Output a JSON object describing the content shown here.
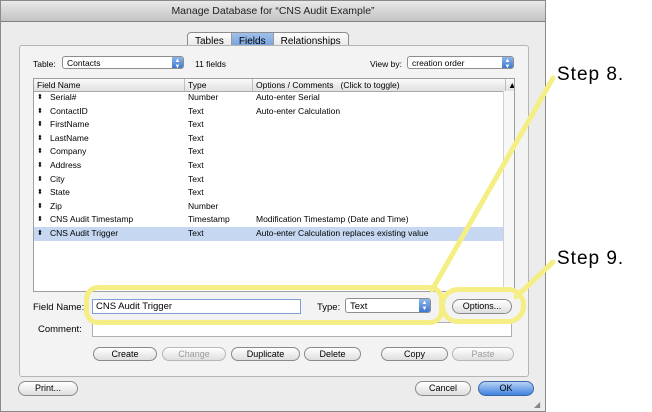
{
  "window": {
    "title": "Manage Database for “CNS Audit Example”"
  },
  "tabs": [
    {
      "label": "Tables",
      "active": false
    },
    {
      "label": "Fields",
      "active": true
    },
    {
      "label": "Relationships",
      "active": false
    }
  ],
  "toolbar": {
    "table_label": "Table:",
    "table_value": "Contacts",
    "field_count": "11 fields",
    "viewby_label": "View by:",
    "viewby_value": "creation order"
  },
  "columns": [
    "Field Name",
    "Type",
    "Options / Comments   (Click to toggle)"
  ],
  "fields": [
    {
      "name": "Serial#",
      "type": "Number",
      "options": "Auto-enter Serial"
    },
    {
      "name": "ContactID",
      "type": "Text",
      "options": "Auto-enter Calculation"
    },
    {
      "name": "FirstName",
      "type": "Text",
      "options": ""
    },
    {
      "name": "LastName",
      "type": "Text",
      "options": ""
    },
    {
      "name": "Company",
      "type": "Text",
      "options": ""
    },
    {
      "name": "Address",
      "type": "Text",
      "options": ""
    },
    {
      "name": "City",
      "type": "Text",
      "options": ""
    },
    {
      "name": "State",
      "type": "Text",
      "options": ""
    },
    {
      "name": "Zip",
      "type": "Number",
      "options": ""
    },
    {
      "name": "CNS Audit Timestamp",
      "type": "Timestamp",
      "options": "Modification Timestamp (Date and Time)"
    },
    {
      "name": "CNS Audit Trigger",
      "type": "Text",
      "options": "Auto-enter Calculation replaces existing value",
      "selected": true
    }
  ],
  "form": {
    "field_name_label": "Field Name:",
    "field_name_value": "CNS Audit Trigger",
    "type_label": "Type:",
    "type_value": "Text",
    "options_button": "Options...",
    "comment_label": "Comment:"
  },
  "buttons": {
    "create": "Create",
    "change": "Change",
    "duplicate": "Duplicate",
    "delete": "Delete",
    "copy": "Copy",
    "paste": "Paste",
    "print": "Print...",
    "cancel": "Cancel",
    "ok": "OK"
  },
  "annotations": {
    "step8": "Step 8.",
    "step9": "Step 9.",
    "highlight_color": "#f4ee84"
  }
}
